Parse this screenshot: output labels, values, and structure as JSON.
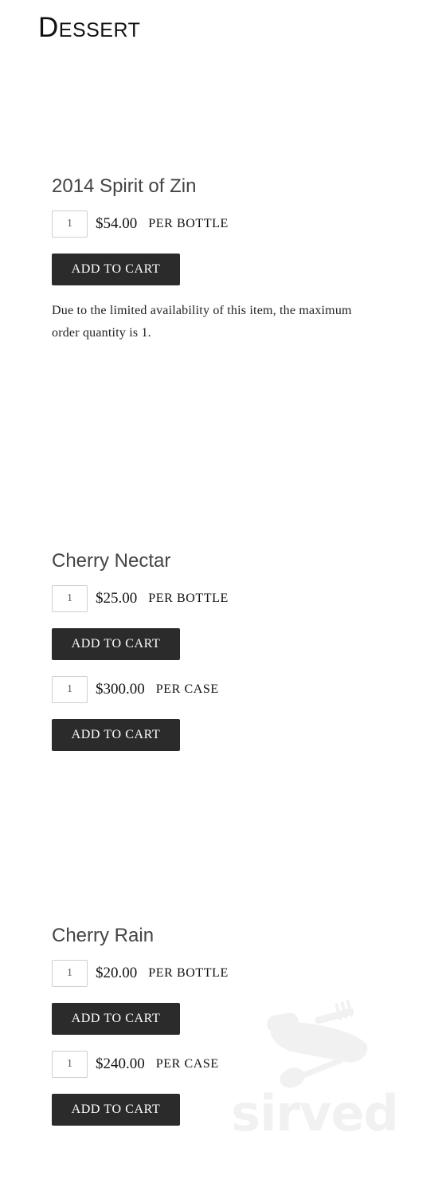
{
  "section": {
    "title": "Dessert"
  },
  "products": [
    {
      "name": "2014 Spirit of Zin",
      "offers": [
        {
          "qty": "1",
          "price": "$54.00",
          "unit": "PER BOTTLE",
          "button": "ADD TO CART"
        }
      ],
      "note": "Due to the limited availability of this item, the maximum order quantity is 1."
    },
    {
      "name": "Cherry Nectar",
      "offers": [
        {
          "qty": "1",
          "price": "$25.00",
          "unit": "PER BOTTLE",
          "button": "ADD TO CART"
        },
        {
          "qty": "1",
          "price": "$300.00",
          "unit": "PER CASE",
          "button": "ADD TO CART"
        }
      ]
    },
    {
      "name": "Cherry Rain",
      "offers": [
        {
          "qty": "1",
          "price": "$20.00",
          "unit": "PER BOTTLE",
          "button": "ADD TO CART"
        },
        {
          "qty": "1",
          "price": "$240.00",
          "unit": "PER CASE",
          "button": "ADD TO CART"
        }
      ]
    }
  ],
  "watermark": {
    "text": "sirved",
    "icon": "cutlery-knife-icon",
    "color": "#f1f1f1"
  }
}
